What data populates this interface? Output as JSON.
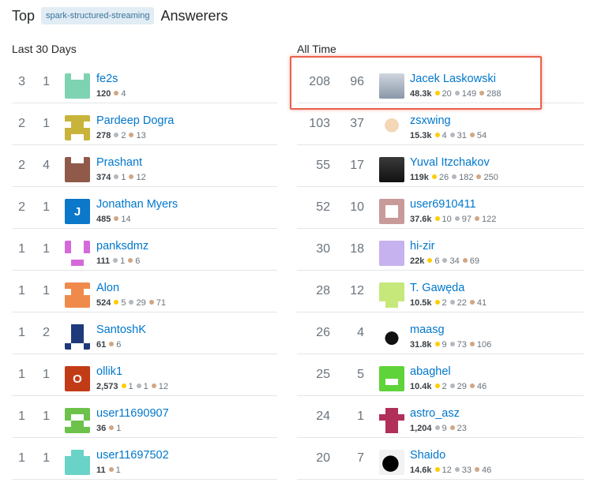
{
  "header": {
    "prefix": "Top",
    "tag": "spark-structured-streaming",
    "suffix": "Answerers"
  },
  "columns": {
    "left_title": "Last 30 Days",
    "right_title": "All Time"
  },
  "colors": {
    "link": "#0077cc",
    "tag_bg": "#e1ecf4",
    "tag_text": "#39739d",
    "gold": "#ffcc01",
    "silver": "#b4b8bc",
    "bronze": "#d1a684",
    "highlight": "#e8604c"
  },
  "last30": [
    {
      "score": "3",
      "answers": "1",
      "name": "fe2s",
      "rep": "120",
      "gold": "",
      "silver": "",
      "bronze": "4",
      "avatar": "identicon-mint"
    },
    {
      "score": "2",
      "answers": "1",
      "name": "Pardeep Dogra",
      "rep": "278",
      "gold": "",
      "silver": "2",
      "bronze": "13",
      "avatar": "identicon-olive"
    },
    {
      "score": "2",
      "answers": "4",
      "name": "Prashant",
      "rep": "374",
      "gold": "",
      "silver": "1",
      "bronze": "12",
      "avatar": "identicon-brown"
    },
    {
      "score": "2",
      "answers": "1",
      "name": "Jonathan Myers",
      "rep": "485",
      "gold": "",
      "silver": "",
      "bronze": "14",
      "avatar": "letter-J"
    },
    {
      "score": "1",
      "answers": "1",
      "name": "panksdmz",
      "rep": "111",
      "gold": "",
      "silver": "1",
      "bronze": "6",
      "avatar": "identicon-magenta"
    },
    {
      "score": "1",
      "answers": "1",
      "name": "Alon",
      "rep": "524",
      "gold": "5",
      "silver": "29",
      "bronze": "71",
      "avatar": "identicon-orange"
    },
    {
      "score": "1",
      "answers": "2",
      "name": "SantoshK",
      "rep": "61",
      "gold": "",
      "silver": "",
      "bronze": "6",
      "avatar": "identicon-navy"
    },
    {
      "score": "1",
      "answers": "1",
      "name": "ollik1",
      "rep": "2,573",
      "gold": "1",
      "silver": "1",
      "bronze": "12",
      "avatar": "letter-O"
    },
    {
      "score": "1",
      "answers": "1",
      "name": "user11690907",
      "rep": "36",
      "gold": "",
      "silver": "",
      "bronze": "1",
      "avatar": "identicon-green"
    },
    {
      "score": "1",
      "answers": "1",
      "name": "user11697502",
      "rep": "11",
      "gold": "",
      "silver": "",
      "bronze": "1",
      "avatar": "identicon-teal"
    }
  ],
  "alltime": [
    {
      "score": "208",
      "answers": "96",
      "name": "Jacek Laskowski",
      "rep": "48.3k",
      "gold": "20",
      "silver": "149",
      "bronze": "288",
      "avatar": "photo-portrait"
    },
    {
      "score": "103",
      "answers": "37",
      "name": "zsxwing",
      "rep": "15.3k",
      "gold": "4",
      "silver": "31",
      "bronze": "54",
      "avatar": "photo-cartoon"
    },
    {
      "score": "55",
      "answers": "17",
      "name": "Yuval Itzchakov",
      "rep": "119k",
      "gold": "26",
      "silver": "182",
      "bronze": "250",
      "avatar": "photo-dark"
    },
    {
      "score": "52",
      "answers": "10",
      "name": "user6910411",
      "rep": "37.6k",
      "gold": "10",
      "silver": "97",
      "bronze": "122",
      "avatar": "identicon-rose"
    },
    {
      "score": "30",
      "answers": "18",
      "name": "hi-zir",
      "rep": "22k",
      "gold": "6",
      "silver": "34",
      "bronze": "69",
      "avatar": "identicon-lavender"
    },
    {
      "score": "28",
      "answers": "12",
      "name": "T. Gawęda",
      "rep": "10.5k",
      "gold": "2",
      "silver": "22",
      "bronze": "41",
      "avatar": "identicon-lime"
    },
    {
      "score": "26",
      "answers": "4",
      "name": "maasg",
      "rep": "31.8k",
      "gold": "9",
      "silver": "73",
      "bronze": "106",
      "avatar": "photo-silhouette"
    },
    {
      "score": "25",
      "answers": "5",
      "name": "abaghel",
      "rep": "10.4k",
      "gold": "2",
      "silver": "29",
      "bronze": "46",
      "avatar": "identicon-brightgreen"
    },
    {
      "score": "24",
      "answers": "1",
      "name": "astro_asz",
      "rep": "1,204",
      "gold": "",
      "silver": "9",
      "bronze": "23",
      "avatar": "identicon-crimson"
    },
    {
      "score": "20",
      "answers": "7",
      "name": "Shaido",
      "rep": "14.6k",
      "gold": "12",
      "silver": "33",
      "bronze": "46",
      "avatar": "photo-shadow"
    }
  ]
}
